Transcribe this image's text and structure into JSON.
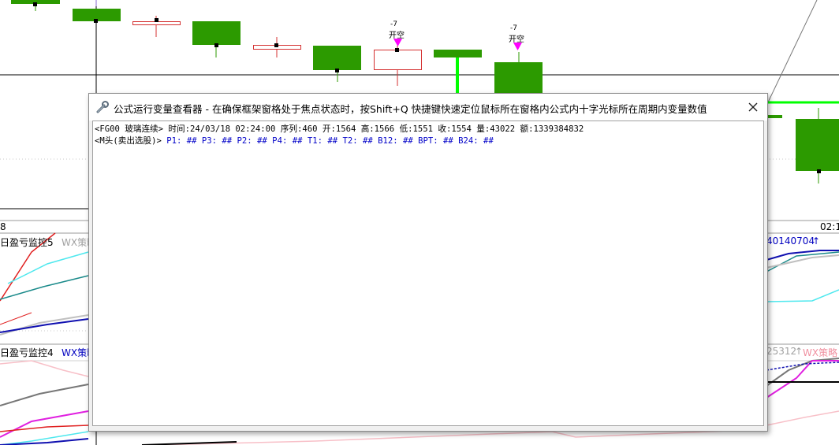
{
  "chart": {
    "signal_labels": [
      {
        "value": "-7",
        "text": "开空"
      },
      {
        "value": "-7",
        "text": "开空"
      }
    ],
    "time_label_left": "8",
    "time_label_right": "02:1",
    "panel1": {
      "title": "日盈亏监控5",
      "tag": "WX策略",
      "right_value": "40140704",
      "arrow": "↑"
    },
    "panel2": {
      "title": "日盈亏监控4",
      "tag": "WX策略",
      "right_value": "25312",
      "arrow": "↑",
      "right_tag": "WX策略"
    }
  },
  "dialog": {
    "title": "公式运行变量查看器 - 在确保框架窗格处于焦点状态时，按Shift+Q 快捷键快速定位鼠标所在窗格内公式内十字光标所在周期内变量数值",
    "icon": "wrench-icon",
    "close_icon": "close-icon",
    "line1": "<FG00 玻璃连续> 时间:24/03/18 02:24:00 序列:460 开:1564 高:1566 低:1551 收:1554 量:43022 额:1339384832",
    "line2_prefix": "<M头(卖出选股)>",
    "line2_vars": "P1: ## P3: ## P2: ## P4: ## T1: ## T2: ## B12: ## BPT: ## B24: ##"
  },
  "colors": {
    "bear_candle": "#2c9a00",
    "bull_candle": "#d43030",
    "signal_arrow": "#ff00ff",
    "bright_green": "#00ff00"
  }
}
